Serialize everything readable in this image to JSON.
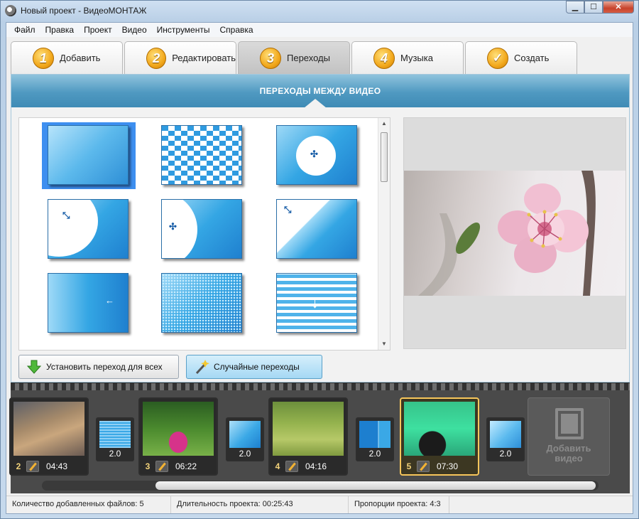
{
  "window": {
    "title": "Новый проект - ВидеоМОНТАЖ",
    "min": "▁",
    "max": "☐",
    "close": "✕"
  },
  "menu": [
    "Файл",
    "Правка",
    "Проект",
    "Видео",
    "Инструменты",
    "Справка"
  ],
  "tabs": [
    {
      "num": "1",
      "label": "Добавить"
    },
    {
      "num": "2",
      "label": "Редактировать"
    },
    {
      "num": "3",
      "label": "Переходы",
      "active": true
    },
    {
      "num": "4",
      "label": "Музыка"
    },
    {
      "num": "✓",
      "label": "Создать"
    }
  ],
  "section": {
    "title": "ПЕРЕХОДЫ МЕЖДУ ВИДЕО"
  },
  "transitions_grid": {
    "selected_index": 0,
    "count": 9
  },
  "buttons": {
    "apply_all": "Установить переход для всех",
    "random": "Случайные переходы"
  },
  "timeline": {
    "clips": [
      {
        "num": "2",
        "time": "04:43"
      },
      {
        "num": "3",
        "time": "06:22"
      },
      {
        "num": "4",
        "time": "04:16"
      },
      {
        "num": "5",
        "time": "07:30",
        "selected": true
      }
    ],
    "transitions": [
      {
        "duration": "2.0"
      },
      {
        "duration": "2.0"
      },
      {
        "duration": "2.0"
      },
      {
        "duration": "2.0"
      }
    ],
    "add_video": {
      "line1": "Добавить",
      "line2": "видео"
    }
  },
  "status": {
    "files": "Количество добавленных файлов: 5",
    "duration": "Длительность проекта:  00:25:43",
    "aspect": "Пропорции проекта:  4:3"
  },
  "colors": {
    "accent": "#4f99c1",
    "selection": "#3d8ff0",
    "timeline_bg": "#4a4a4a",
    "clip_selected": "#f7c65b"
  }
}
